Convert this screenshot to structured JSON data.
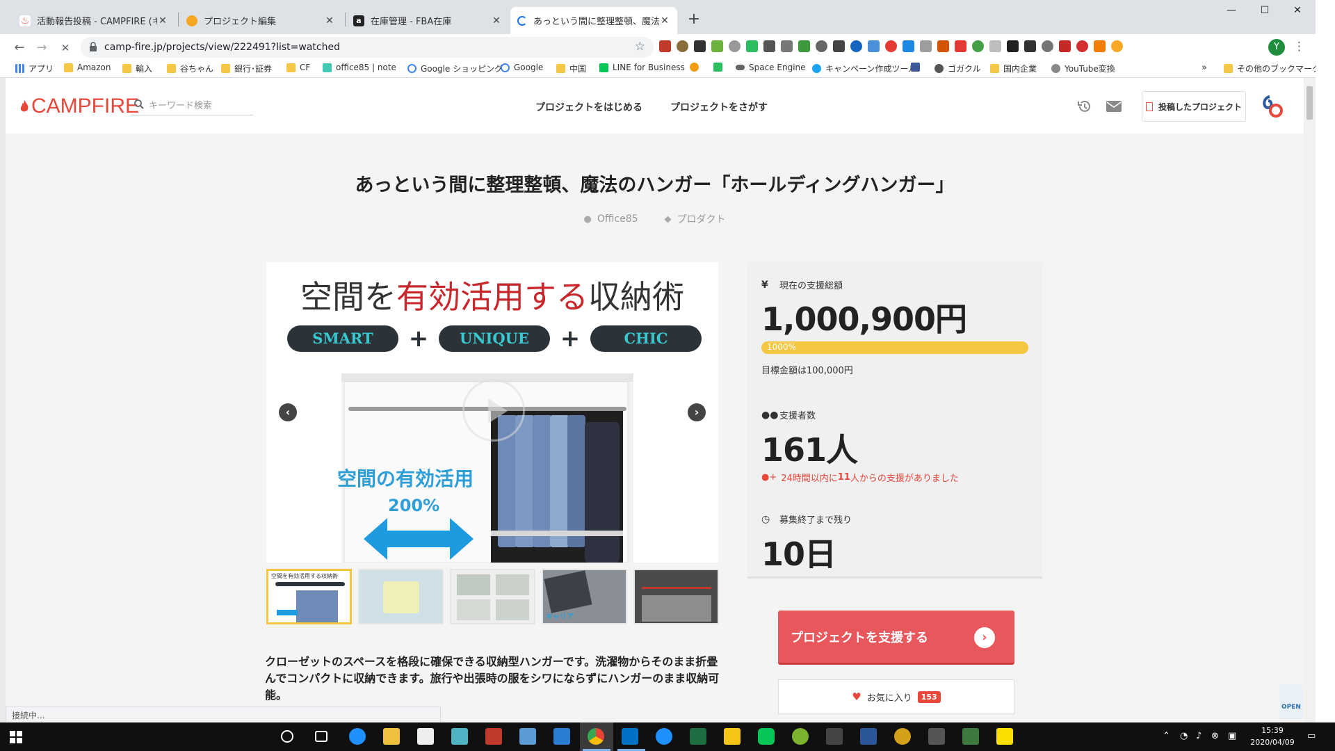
{
  "browser": {
    "tabs": [
      {
        "title": "活動報告投稿 - CAMPFIRE (キャンプファイヤー)",
        "favicon_color": "#e8473b",
        "active": false
      },
      {
        "title": "プロジェクト編集",
        "favicon_color": "#f5a623",
        "active": false
      },
      {
        "title": "在庫管理 - FBA在庫",
        "favicon_color": "#222222",
        "active": false
      },
      {
        "title": "あっという間に整理整頓、魔法のハンガー",
        "favicon_color": "#1a73e8",
        "active": true
      }
    ],
    "tab_close": "✕",
    "new_tab": "+",
    "window_controls": {
      "minimize": "—",
      "maximize": "☐",
      "close": "✕"
    },
    "nav": {
      "back": "←",
      "forward": "→",
      "stop": "✕"
    },
    "url": "camp-fire.jp/projects/view/222491?list=watched",
    "bookmark_star": "☆",
    "profile_initial": "Y",
    "menu": "⋮",
    "bookmarks": [
      {
        "label": "アプリ",
        "icon": "apps-grid"
      },
      {
        "label": "Amazon",
        "icon": "folder"
      },
      {
        "label": "輸入",
        "icon": "folder"
      },
      {
        "label": "谷ちゃん",
        "icon": "folder"
      },
      {
        "label": "銀行･証券",
        "icon": "folder"
      },
      {
        "label": "CF",
        "icon": "folder"
      },
      {
        "label": "office85 | note",
        "icon": "note"
      },
      {
        "label": "Google ショッピング",
        "icon": "google"
      },
      {
        "label": "Google",
        "icon": "google"
      },
      {
        "label": "中国",
        "icon": "folder"
      },
      {
        "label": "LINE for Business",
        "icon": "line"
      },
      {
        "label": "",
        "icon": "ext-orange"
      },
      {
        "label": "",
        "icon": "evernote"
      },
      {
        "label": "Space Engine",
        "icon": "link"
      },
      {
        "label": "キャンペーン作成ツール",
        "icon": "twitter"
      },
      {
        "label": "",
        "icon": "facebook"
      },
      {
        "label": "ゴガクル",
        "icon": "globe"
      },
      {
        "label": "国内企業",
        "icon": "folder"
      },
      {
        "label": "YouTube変換",
        "icon": "youtube-convert"
      }
    ],
    "bookmarks_more": "»",
    "other_bookmarks": "その他のブックマーク",
    "status": "接続中..."
  },
  "site": {
    "logo": "CAMPFIRE",
    "search_placeholder": "キーワード検索",
    "nav": {
      "start": "プロジェクトをはじめる",
      "find": "プロジェクトをさがす"
    },
    "posted_projects": "投稿したプロジェクト"
  },
  "project": {
    "title": "あっという間に整理整頓、魔法のハンガー「ホールディングハンガー」",
    "author": "Office85",
    "category": "プロダクト",
    "hero": {
      "line1_pre": "空間を",
      "line1_red": "有効活用する",
      "line1_post": "収納術",
      "pills": [
        "SMART",
        "UNIQUE",
        "CHIC"
      ],
      "plus": "+",
      "benefit": "空間の有効活用",
      "benefit_pct": "200%"
    },
    "carousel": {
      "prev": "‹",
      "next": "›"
    },
    "thumb_labels": [
      "空間を有効活用する収納術",
      "",
      "",
      "キャリア",
      ""
    ],
    "description": "クローゼットのスペースを格段に確保できる収納型ハンガーです。洗濯物からそのまま折畳んでコンパクトに収納できます。旅行や出張時の服をシワにならずにハンガーのまま収納可能。"
  },
  "stats": {
    "total_label": "現在の支援総額",
    "total_value": "1,000,900円",
    "progress_percent": "1000%",
    "progress_fraction": 1.0,
    "goal": "目標金額は100,000円",
    "supporters_label": "支援者数",
    "supporters_value": "161人",
    "recent_pre": "24時間以内に",
    "recent_count": "11",
    "recent_post": "人からの支援がありました",
    "remaining_label": "募集終了まで残り",
    "remaining_value": "10日"
  },
  "actions": {
    "support": "プロジェクトを支援する",
    "favorite": "お気に入り",
    "favorite_count": "153"
  },
  "widget": {
    "label": "OPEN"
  },
  "taskbar": {
    "clock_time": "15:39",
    "clock_date": "2020/04/09"
  },
  "colors": {
    "brand": "#e8473b",
    "progress": "#f5c642",
    "support_button": "#e8575b",
    "hero_red": "#c8282c",
    "pill_text": "#37c9cf",
    "benefit_blue": "#2e9ed6"
  }
}
